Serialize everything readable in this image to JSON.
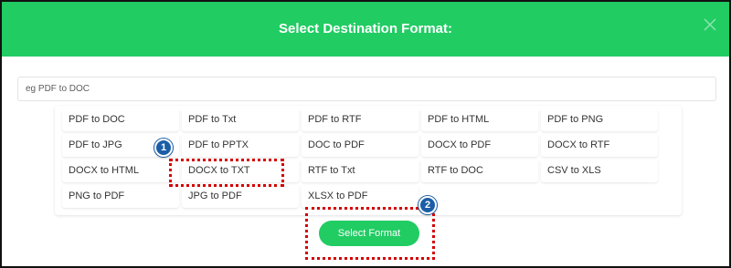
{
  "modal": {
    "title": "Select Destination Format:",
    "close_icon": "close-icon",
    "search_placeholder": "eg PDF to DOC",
    "formats": [
      "PDF to DOC",
      "PDF to Txt",
      "PDF to RTF",
      "PDF to HTML",
      "PDF to PNG",
      "PDF to JPG",
      "PDF to PPTX",
      "DOC to PDF",
      "DOCX to PDF",
      "DOCX to RTF",
      "DOCX to HTML",
      "DOCX to TXT",
      "RTF to Txt",
      "RTF to DOC",
      "CSV to XLS",
      "PNG to PDF",
      "JPG to PDF",
      "XLSX to PDF"
    ],
    "select_button": "Select Format"
  },
  "annotations": {
    "badge_1": "1",
    "badge_2": "2"
  },
  "colors": {
    "header": "#21cc63",
    "button": "#21cc63",
    "highlight": "#d40000",
    "badge": "#1b5ea7"
  }
}
